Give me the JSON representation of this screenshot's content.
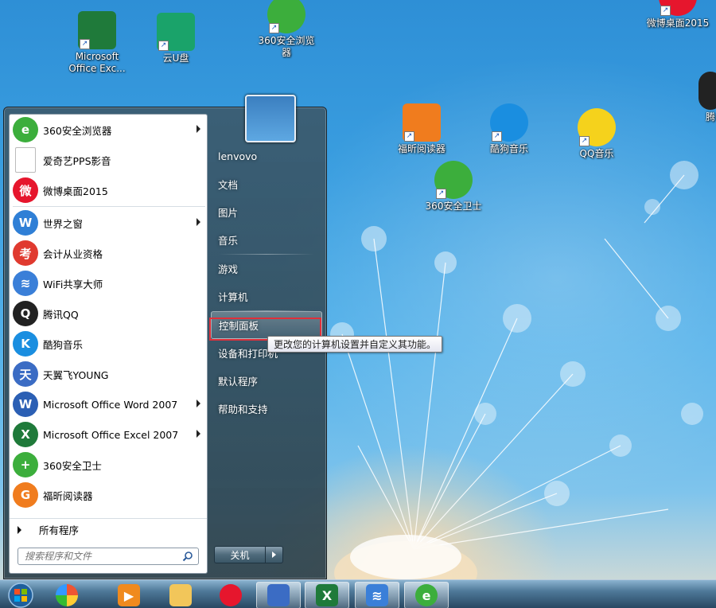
{
  "desktop": {
    "icons": [
      {
        "label": "Microsoft Office Exc...",
        "icon": "excel-icon"
      },
      {
        "label": "云U盘",
        "icon": "cloud-disk-icon"
      },
      {
        "label": "360安全浏览器",
        "icon": "360-browser-icon"
      },
      {
        "label": "微博桌面2015",
        "icon": "weibo-icon"
      },
      {
        "label": "福昕阅读器",
        "icon": "foxit-reader-icon"
      },
      {
        "label": "酷狗音乐",
        "icon": "kugou-icon"
      },
      {
        "label": "QQ音乐",
        "icon": "qq-music-icon"
      },
      {
        "label": "360安全卫士",
        "icon": "360-guard-icon"
      },
      {
        "label": "腾",
        "icon": "tencent-icon"
      }
    ]
  },
  "start_menu": {
    "programs": [
      {
        "label": "360安全浏览器",
        "icon": "360-browser-icon",
        "submenu": true,
        "color": "#3cae3c",
        "glyph": "e"
      },
      {
        "label": "爱奇艺PPS影音",
        "icon": "file-icon",
        "submenu": false,
        "color": "#ffffff",
        "glyph": ""
      },
      {
        "label": "微博桌面2015",
        "icon": "weibo-icon",
        "submenu": false,
        "color": "#e6162d",
        "glyph": "微"
      },
      {
        "label": "世界之窗",
        "icon": "theworld-browser-icon",
        "submenu": true,
        "color": "#2f7fd6",
        "glyph": "W"
      },
      {
        "label": "会计从业资格",
        "icon": "exam-icon",
        "submenu": false,
        "color": "#e03a2f",
        "glyph": "考"
      },
      {
        "label": "WiFi共享大师",
        "icon": "wifi-icon",
        "submenu": false,
        "color": "#3a7fd8",
        "glyph": "≋"
      },
      {
        "label": "腾讯QQ",
        "icon": "qq-icon",
        "submenu": false,
        "color": "#222222",
        "glyph": "Q"
      },
      {
        "label": "酷狗音乐",
        "icon": "kugou-icon",
        "submenu": false,
        "color": "#1a8ee0",
        "glyph": "K"
      },
      {
        "label": "天翼飞YOUNG",
        "icon": "tianyi-icon",
        "submenu": false,
        "color": "#3b6cc4",
        "glyph": "天"
      },
      {
        "label": "Microsoft Office Word 2007",
        "icon": "word-icon",
        "submenu": true,
        "color": "#2b5fb4",
        "glyph": "W"
      },
      {
        "label": "Microsoft Office Excel 2007",
        "icon": "excel-icon",
        "submenu": true,
        "color": "#1f7a3a",
        "glyph": "X"
      },
      {
        "label": "360安全卫士",
        "icon": "360-guard-icon",
        "submenu": false,
        "color": "#3cae3c",
        "glyph": "+"
      },
      {
        "label": "福昕阅读器",
        "icon": "foxit-reader-icon",
        "submenu": false,
        "color": "#f07c1e",
        "glyph": "G"
      }
    ],
    "all_programs": "所有程序",
    "search_placeholder": "搜索程序和文件",
    "right_items": [
      "lenvovo",
      "文档",
      "图片",
      "音乐",
      "游戏",
      "计算机",
      "控制面板",
      "设备和打印机",
      "默认程序",
      "帮助和支持"
    ],
    "shutdown_label": "关机",
    "tooltip": "更改您的计算机设置并自定义其功能。"
  },
  "taskbar": {
    "pinned": [
      {
        "icon": "windows-start-orb-icon"
      },
      {
        "icon": "picasa-icon"
      },
      {
        "icon": "video-player-icon"
      },
      {
        "icon": "file-explorer-icon"
      },
      {
        "icon": "weibo-icon"
      },
      {
        "icon": "tianyi-icon"
      },
      {
        "icon": "excel-icon"
      },
      {
        "icon": "wifi-icon"
      },
      {
        "icon": "360-browser-icon"
      }
    ]
  }
}
